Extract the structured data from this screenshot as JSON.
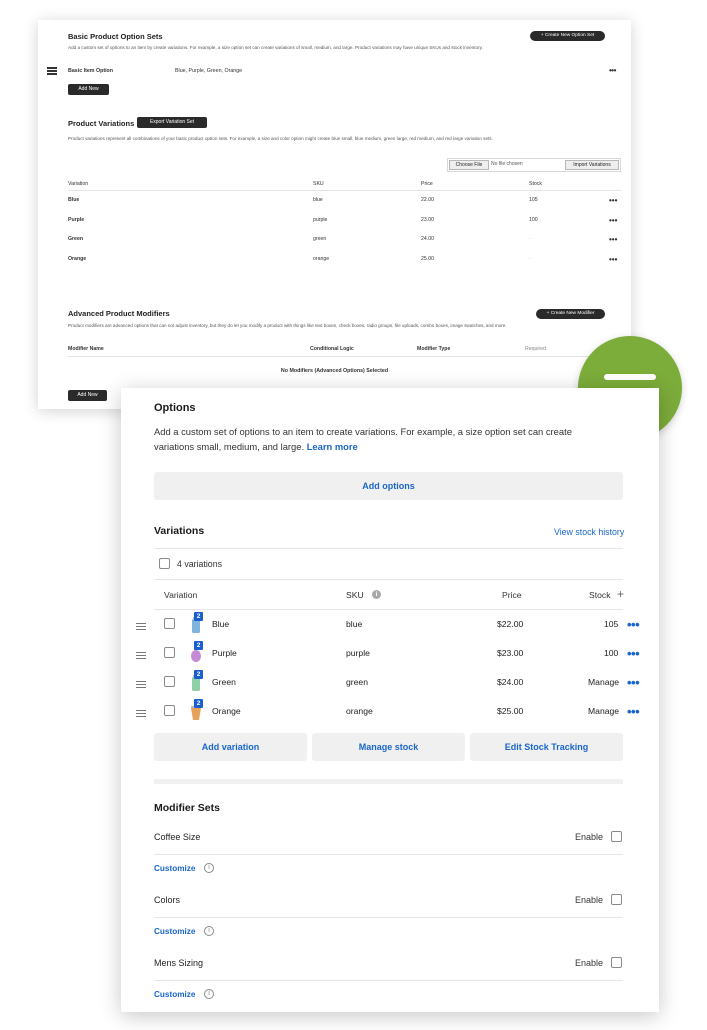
{
  "back_panel": {
    "basic_sets_title": "Basic Product Option Sets",
    "basic_sets_desc": "Add a custom set of options to an item by create variations. For example, a size option set can create variations of small, medium, and large. Product variations may have unique SKUs and stock inventory.",
    "create_option_set_button": "+ Create New Option Set",
    "basic_item_option_label": "Basic Item Option",
    "basic_item_option_values": "Blue, Purple, Green, Orange",
    "add_new_button": "Add New",
    "variations_title": "Product Variations",
    "export_button": "Export Variation Set",
    "variations_desc": "Product variations represent all combinations of your basic product option sets. For example, a size and color option might create blue small, blue medium, green large, red medium, and red large variation sets.",
    "choose_file_button": "Choose File",
    "no_file_text": "No file chosen",
    "import_button": "Import Variations",
    "columns": [
      "Variation",
      "SKU",
      "Price",
      "Stock"
    ],
    "rows": [
      {
        "variation": "Blue",
        "sku": "blue",
        "price": "22.00",
        "stock": "105"
      },
      {
        "variation": "Purple",
        "sku": "purple",
        "price": "23.00",
        "stock": "100"
      },
      {
        "variation": "Green",
        "sku": "green",
        "price": "24.00",
        "stock": "-"
      },
      {
        "variation": "Orange",
        "sku": "orange",
        "price": "25.00",
        "stock": "-"
      }
    ],
    "modifiers_title": "Advanced Product Modifiers",
    "create_modifier_button": "+ Create New Modifier",
    "modifiers_desc": "Product modifiers are advanced options that can not adjust inventory, but they do let you modify a product with things like text boxes, check boxes, radio groups, file uploads, combo boxes, image swatches, and more.",
    "modifier_columns": [
      "Modifier Name",
      "Conditional Logic",
      "Modifier Type",
      "Required"
    ],
    "no_modifiers_text": "No Modifiers (Advanced Options) Selected",
    "add_new_button_2": "Add New"
  },
  "badge": {
    "color": "#7cac3a",
    "icon": "equals-icon"
  },
  "front_panel": {
    "options_title": "Options",
    "options_desc": "Add a custom set of options to an item to create variations. For example, a size option set can create variations small, medium, and large.",
    "learn_more": "Learn more",
    "add_options_button": "Add options",
    "variations_title": "Variations",
    "view_stock_history": "View stock history",
    "variations_count": "4 variations",
    "columns": {
      "variation": "Variation",
      "sku": "SKU",
      "price": "Price",
      "stock": "Stock"
    },
    "rows": [
      {
        "name": "Blue",
        "sku": "blue",
        "price": "$22.00",
        "stock": "105",
        "badge": "2",
        "color": "#7fb4e0"
      },
      {
        "name": "Purple",
        "sku": "purple",
        "price": "$23.00",
        "stock": "100",
        "badge": "2",
        "color": "#c48ad6"
      },
      {
        "name": "Green",
        "sku": "green",
        "price": "$24.00",
        "stock": "Manage",
        "badge": "2",
        "color": "#8fd0a8"
      },
      {
        "name": "Orange",
        "sku": "orange",
        "price": "$25.00",
        "stock": "Manage",
        "badge": "2",
        "color": "#e6a25a"
      }
    ],
    "add_variation_button": "Add variation",
    "manage_stock_button": "Manage stock",
    "edit_stock_tracking_button": "Edit Stock Tracking",
    "modifier_sets_title": "Modifier Sets",
    "modifier_sets": [
      {
        "name": "Coffee Size",
        "enable_label": "Enable",
        "customize": "Customize"
      },
      {
        "name": "Colors",
        "enable_label": "Enable",
        "customize": "Customize"
      },
      {
        "name": "Mens Sizing",
        "enable_label": "Enable",
        "customize": "Customize"
      }
    ],
    "accent_color": "#1a66c9"
  }
}
